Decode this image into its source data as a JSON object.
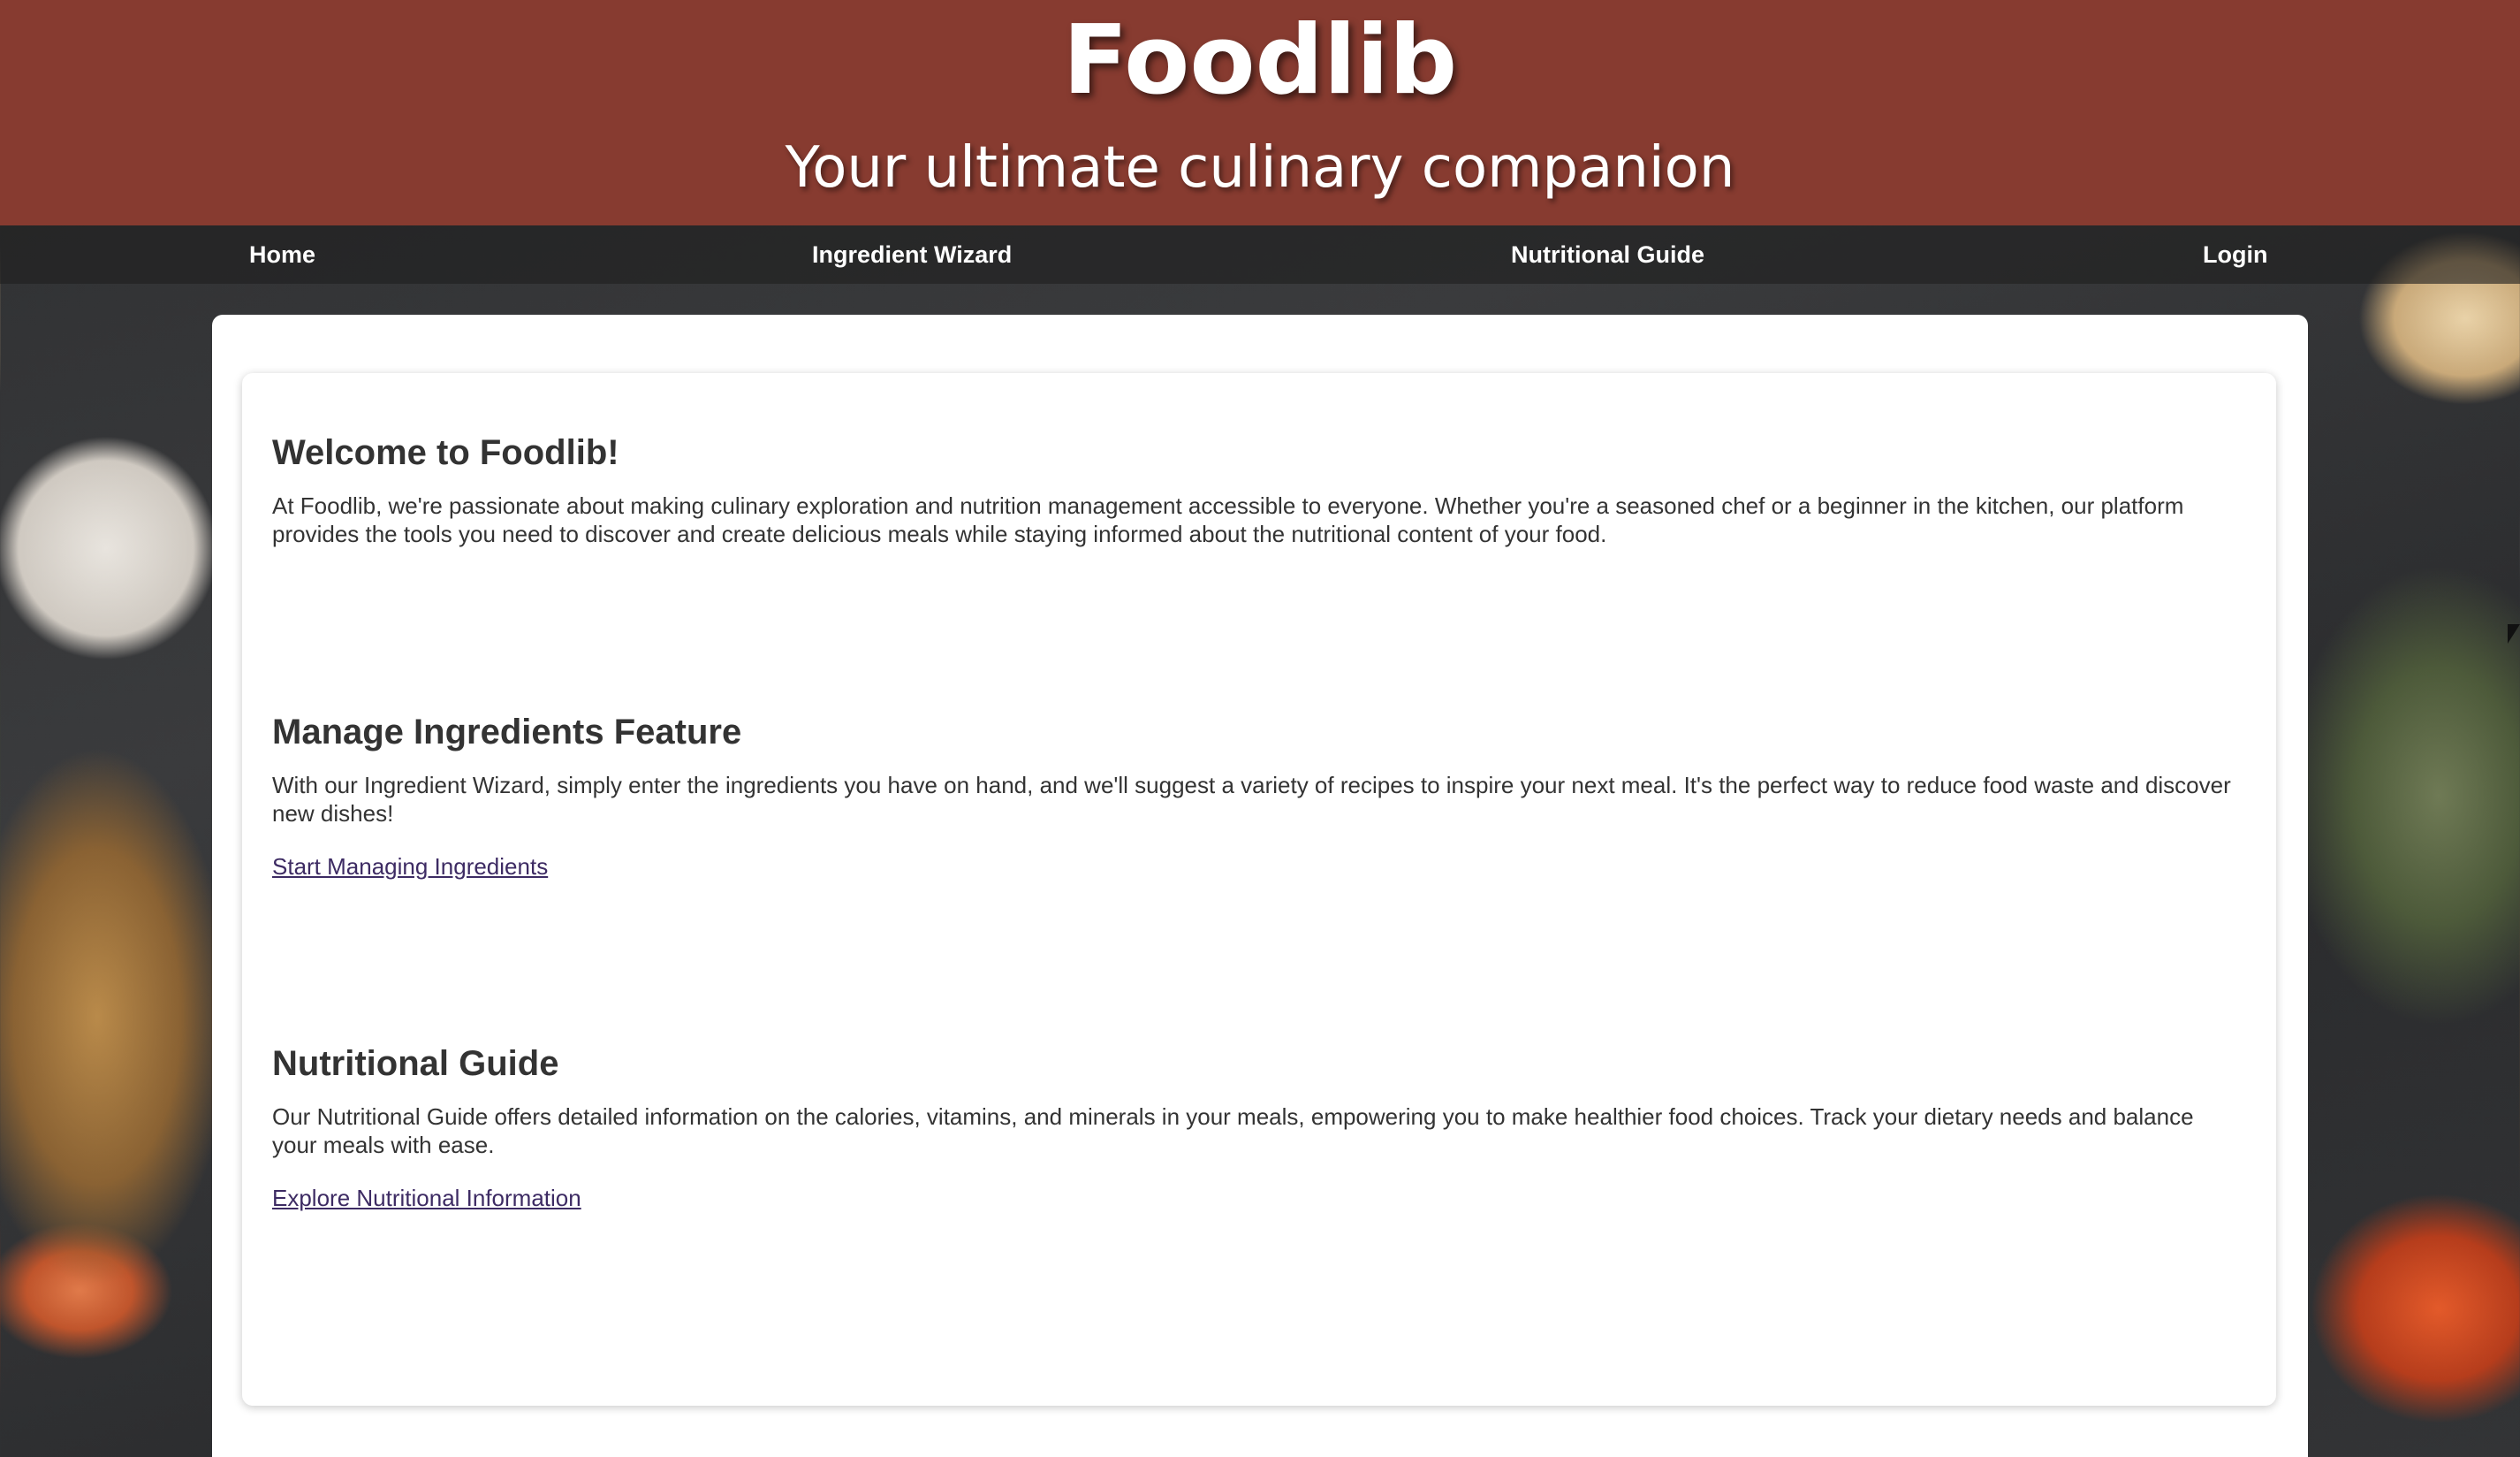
{
  "header": {
    "title": "Foodlib",
    "tagline": "Your ultimate culinary companion"
  },
  "nav": {
    "items": [
      {
        "label": "Home"
      },
      {
        "label": "Ingredient Wizard"
      },
      {
        "label": "Nutritional Guide"
      },
      {
        "label": "Login"
      }
    ]
  },
  "main": {
    "sections": [
      {
        "heading": "Welcome to Foodlib!",
        "body": "At Foodlib, we're passionate about making culinary exploration and nutrition management accessible to everyone. Whether you're a seasoned chef or a beginner in the kitchen, our platform provides the tools you need to discover and create delicious meals while staying informed about the nutritional content of your food."
      },
      {
        "heading": "Manage Ingredients Feature",
        "body": "With our Ingredient Wizard, simply enter the ingredients you have on hand, and we'll suggest a variety of recipes to inspire your next meal. It's the perfect way to reduce food waste and discover new dishes!",
        "link": "Start Managing Ingredients"
      },
      {
        "heading": "Nutritional Guide",
        "body": "Our Nutritional Guide offers detailed information on the calories, vitamins, and minerals in your meals, empowering you to make healthier food choices. Track your dietary needs and balance your meals with ease.",
        "link": "Explore Nutritional Information"
      }
    ]
  },
  "colors": {
    "header_bg": "#873b30",
    "link": "#3d2b63",
    "text": "#333333"
  }
}
